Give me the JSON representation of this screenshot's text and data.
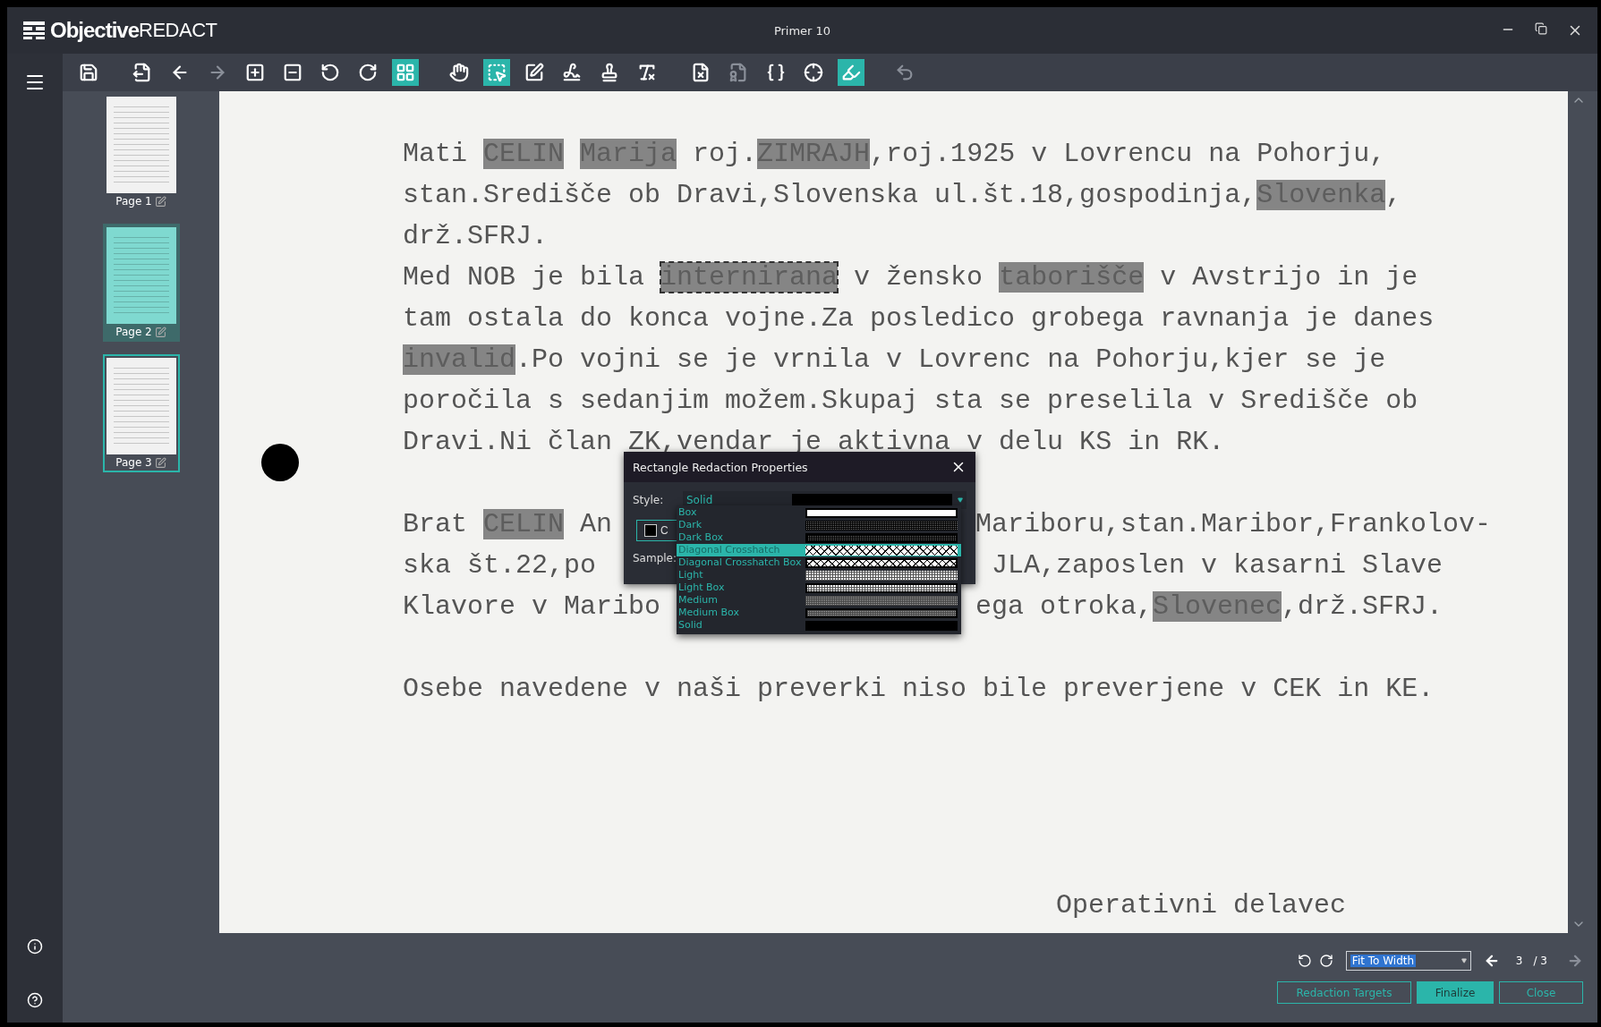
{
  "window": {
    "logo_bold": "Objective",
    "logo_light": "REDACT",
    "title": "Primer 10"
  },
  "toolbar": [
    {
      "selected": false,
      "disabled": false
    },
    {
      "selected": false,
      "disabled": false
    },
    {
      "selected": false,
      "disabled": false
    },
    {
      "selected": false,
      "disabled": true
    },
    {
      "selected": false,
      "disabled": false
    },
    {
      "selected": false,
      "disabled": false
    },
    {
      "selected": false,
      "disabled": false
    },
    {
      "selected": false,
      "disabled": false
    },
    {
      "selected": true,
      "disabled": false
    },
    {
      "selected": false,
      "disabled": false
    },
    {
      "selected": true,
      "disabled": false
    },
    {
      "selected": false,
      "disabled": false
    },
    {
      "selected": false,
      "disabled": false
    },
    {
      "selected": false,
      "disabled": false
    },
    {
      "selected": false,
      "disabled": false
    },
    {
      "selected": false,
      "disabled": false
    },
    {
      "selected": false,
      "disabled": true
    },
    {
      "selected": false,
      "disabled": false
    },
    {
      "selected": false,
      "disabled": false
    },
    {
      "selected": true,
      "disabled": false
    },
    {
      "selected": false,
      "disabled": true
    }
  ],
  "thumbnails": [
    {
      "label": "Page 1",
      "selected": false,
      "highlighted": false
    },
    {
      "label": "Page 2",
      "selected": false,
      "highlighted": true
    },
    {
      "label": "Page 3",
      "selected": true,
      "highlighted": false
    }
  ],
  "document": {
    "paragraphs": [
      {
        "lines": [
          {
            "segments": [
              {
                "kind": "text",
                "text": "Mati "
              },
              {
                "kind": "redaction",
                "text": "CELIN",
                "selected": false
              },
              {
                "kind": "redaction",
                "text": "Marija",
                "selected": false
              },
              {
                "kind": "text",
                "text": " roj."
              },
              {
                "kind": "redaction",
                "text": "ZIMRAJH",
                "selected": false
              },
              {
                "kind": "text",
                "text": ",roj.1925 v Lovrencu na Pohorju,"
              }
            ]
          },
          {
            "segments": [
              {
                "kind": "text",
                "text": "stan.Središče ob Dravi,Slovenska ul.št.18,gospodinja,"
              },
              {
                "kind": "redaction",
                "text": "Slovenka",
                "selected": false
              },
              {
                "kind": "text",
                "text": ","
              }
            ]
          },
          {
            "segments": [
              {
                "kind": "text",
                "text": "drž.SFRJ."
              }
            ]
          },
          {
            "segments": [
              {
                "kind": "text",
                "text": "Med NOB je bila "
              },
              {
                "kind": "redaction",
                "text": "internirana",
                "selected": true
              },
              {
                "kind": "text",
                "text": " v žensko "
              },
              {
                "kind": "redaction",
                "text": "taborišče",
                "selected": false
              },
              {
                "kind": "text",
                "text": " v Avstrijo in je"
              }
            ]
          },
          {
            "segments": [
              {
                "kind": "text",
                "text": "tam ostala do konca vojne.Za posledico grobega ravnanja je danes"
              }
            ]
          },
          {
            "segments": [
              {
                "kind": "redaction",
                "text": "invalid",
                "selected": false
              },
              {
                "kind": "text",
                "text": ".Po vojni se je vrnila v Lovrenc na Pohorju,kjer se je"
              }
            ]
          },
          {
            "segments": [
              {
                "kind": "text",
                "text": "poročila s sedanjim možem.Skupaj sta se preselila v Središče ob"
              }
            ]
          },
          {
            "segments": [
              {
                "kind": "text",
                "text": "Dravi.Ni član ZK,vendar je aktivna v delu KS in RK."
              }
            ]
          }
        ]
      },
      {
        "lines": [
          {
            "segments": [
              {
                "kind": "text",
                "text": "Brat "
              },
              {
                "kind": "redaction",
                "text": "CELIN",
                "selected": false
              },
              {
                "kind": "text",
                "text": " An"
              }
            ],
            "right_segments": [
              {
                "kind": "text",
                "text": "Mariboru,stan.Maribor,Frankolov-"
              }
            ]
          },
          {
            "segments": [
              {
                "kind": "text",
                "text": "ska št.22,po"
              }
            ],
            "right_segments": [
              {
                "kind": "text",
                "text": " JLA,zaposlen v kasarni Slave"
              }
            ]
          },
          {
            "segments": [
              {
                "kind": "text",
                "text": "Klavore v Maribo"
              }
            ],
            "right_segments": [
              {
                "kind": "text",
                "text": "ega otroka,"
              },
              {
                "kind": "redaction",
                "text": "Slovenec",
                "selected": false
              },
              {
                "kind": "text",
                "text": ",drž.SFRJ."
              }
            ]
          }
        ]
      },
      {
        "lines": [
          {
            "segments": [
              {
                "kind": "text",
                "text": "Osebe navedene v naši preverki niso bile preverjene v CEK in KE."
              }
            ]
          }
        ]
      }
    ],
    "signature": "Operativni delavec"
  },
  "dialog": {
    "title": "Rectangle Redaction Properties",
    "style_label": "Style:",
    "style_value": "Solid",
    "color_button": "C",
    "sample_label": "Sample:",
    "options": [
      {
        "label": "Box",
        "kind": "box",
        "selected": false
      },
      {
        "label": "Dark",
        "kind": "dark",
        "selected": false
      },
      {
        "label": "Dark Box",
        "kind": "darkbox",
        "selected": false
      },
      {
        "label": "Diagonal Crosshatch",
        "kind": "crosshatch",
        "selected": true
      },
      {
        "label": "Diagonal Crosshatch Box",
        "kind": "crosshatchbox",
        "selected": false
      },
      {
        "label": "Light",
        "kind": "light",
        "selected": false
      },
      {
        "label": "Light Box",
        "kind": "lightbox",
        "selected": false
      },
      {
        "label": "Medium",
        "kind": "medium",
        "selected": false
      },
      {
        "label": "Medium Box",
        "kind": "mediumbox",
        "selected": false
      },
      {
        "label": "Solid",
        "kind": "solid",
        "selected": false
      }
    ]
  },
  "pager": {
    "zoom": "Fit To Width",
    "page": "3",
    "total": "/ 3"
  },
  "buttons": [
    {
      "label": "Redaction Targets",
      "kind": "outline"
    },
    {
      "label": "Finalize",
      "kind": "primary"
    },
    {
      "label": "Close",
      "kind": "outline"
    }
  ]
}
